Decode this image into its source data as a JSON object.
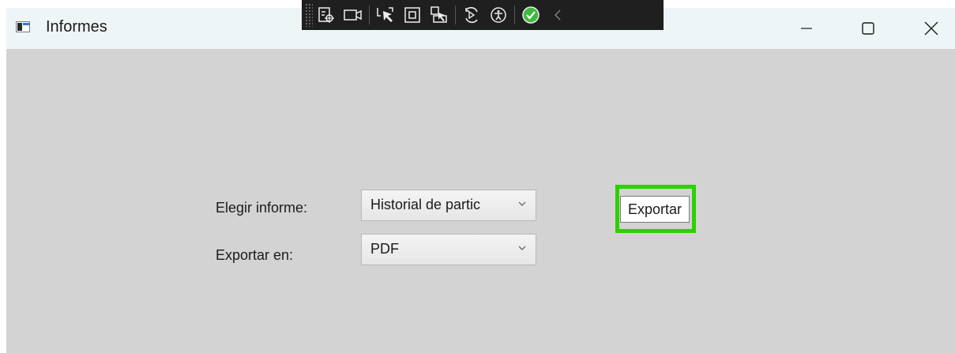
{
  "window": {
    "title": "Informes",
    "controls": {
      "minimize": "minimize-icon",
      "maximize": "maximize-icon",
      "close": "close-icon"
    }
  },
  "debug_toolbar": {
    "tools": [
      "live-visual-tree-icon",
      "record-icon",
      "select-element-icon",
      "display-layout-adorners-icon",
      "track-focus-icon",
      "hot-reload-icon",
      "accessibility-icon",
      "binding-status-icon",
      "collapse-icon"
    ],
    "status_color": "#3fb93f"
  },
  "form": {
    "report_label": "Elegir informe:",
    "report_value": "Historial de partic",
    "format_label": "Exportar en:",
    "format_value": "PDF",
    "export_button": "Exportar"
  },
  "colors": {
    "focus_highlight": "#2bd100",
    "client_background": "#d3d3d3",
    "titlebar_background": "#eef5f7"
  }
}
